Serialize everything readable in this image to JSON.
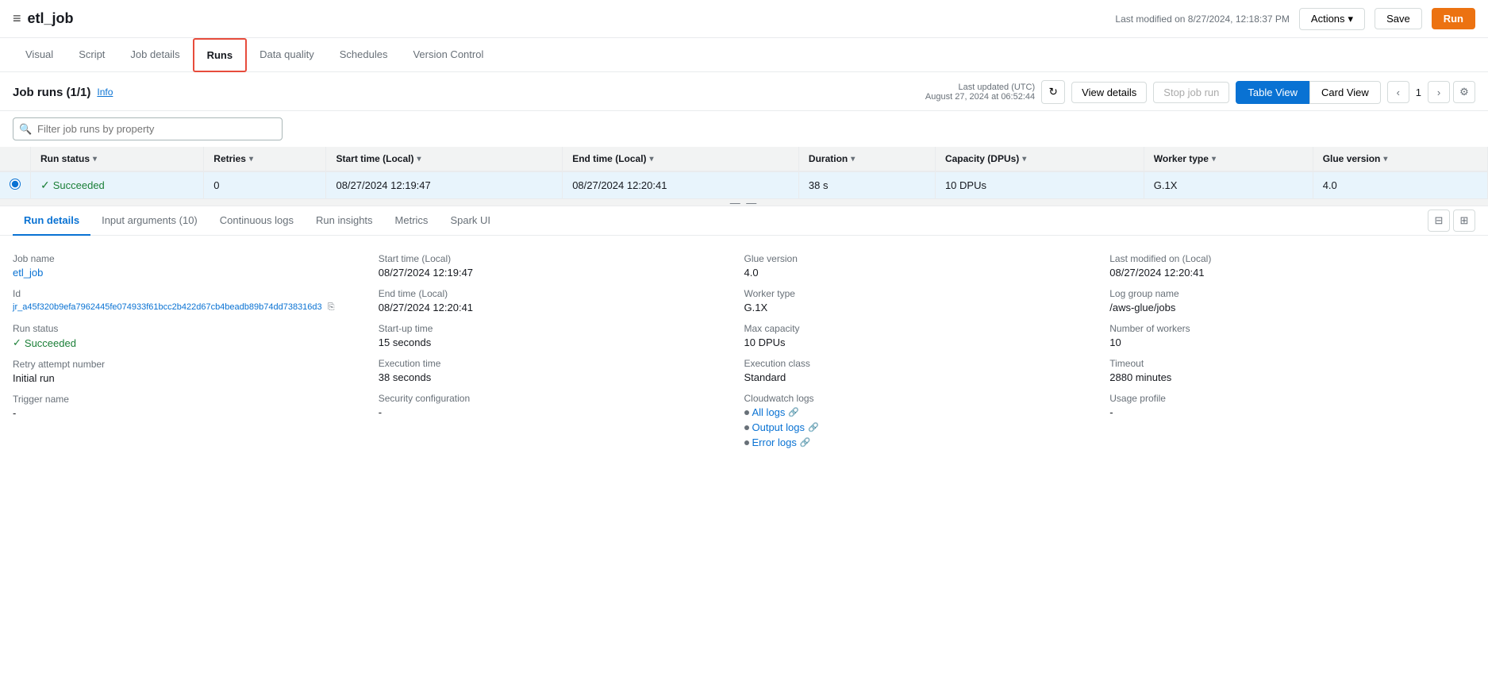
{
  "header": {
    "menu_icon": "≡",
    "job_title": "etl_job",
    "last_modified": "Last modified on 8/27/2024, 12:18:37 PM",
    "actions_label": "Actions",
    "save_label": "Save",
    "run_label": "Run"
  },
  "tabs": [
    {
      "id": "visual",
      "label": "Visual",
      "active": false
    },
    {
      "id": "script",
      "label": "Script",
      "active": false
    },
    {
      "id": "job-details",
      "label": "Job details",
      "active": false
    },
    {
      "id": "runs",
      "label": "Runs",
      "active": true,
      "highlighted": true
    },
    {
      "id": "data-quality",
      "label": "Data quality",
      "active": false
    },
    {
      "id": "schedules",
      "label": "Schedules",
      "active": false
    },
    {
      "id": "version-control",
      "label": "Version Control",
      "active": false
    }
  ],
  "job_runs": {
    "title": "Job runs",
    "count": "(1/1)",
    "info_label": "Info",
    "last_updated_line1": "Last updated (UTC)",
    "last_updated_line2": "August 27, 2024 at 06:52:44",
    "view_details_label": "View details",
    "stop_job_label": "Stop job run",
    "table_view_label": "Table View",
    "card_view_label": "Card View"
  },
  "filter": {
    "placeholder": "Filter job runs by property"
  },
  "table": {
    "columns": [
      {
        "id": "run_status",
        "label": "Run status"
      },
      {
        "id": "retries",
        "label": "Retries"
      },
      {
        "id": "start_time",
        "label": "Start time (Local)"
      },
      {
        "id": "end_time",
        "label": "End time (Local)"
      },
      {
        "id": "duration",
        "label": "Duration"
      },
      {
        "id": "capacity",
        "label": "Capacity (DPUs)"
      },
      {
        "id": "worker_type",
        "label": "Worker type"
      },
      {
        "id": "glue_version",
        "label": "Glue version"
      }
    ],
    "rows": [
      {
        "selected": true,
        "run_status": "Succeeded",
        "retries": "0",
        "start_time": "08/27/2024 12:19:47",
        "end_time": "08/27/2024 12:20:41",
        "duration": "38 s",
        "capacity": "10 DPUs",
        "worker_type": "G.1X",
        "glue_version": "4.0"
      }
    ]
  },
  "pagination": {
    "current_page": "1"
  },
  "bottom_tabs": [
    {
      "id": "run-details",
      "label": "Run details",
      "active": true
    },
    {
      "id": "input-arguments",
      "label": "Input arguments (10)",
      "active": false
    },
    {
      "id": "continuous-logs",
      "label": "Continuous logs",
      "active": false
    },
    {
      "id": "run-insights",
      "label": "Run insights",
      "active": false
    },
    {
      "id": "metrics",
      "label": "Metrics",
      "active": false
    },
    {
      "id": "spark-ui",
      "label": "Spark UI",
      "active": false
    }
  ],
  "run_details": {
    "job_name_label": "Job name",
    "job_name_value": "etl_job",
    "id_label": "Id",
    "id_value": "jr_a45f320b9efa7962445fe074933f61bcc2b422d67cb4beadb89b74dd738316d3",
    "run_status_label": "Run status",
    "run_status_value": "Succeeded",
    "retry_label": "Retry attempt number",
    "retry_value": "Initial run",
    "trigger_label": "Trigger name",
    "trigger_value": "-",
    "start_time_label": "Start time (Local)",
    "start_time_value": "08/27/2024 12:19:47",
    "end_time_label": "End time (Local)",
    "end_time_value": "08/27/2024 12:20:41",
    "startup_time_label": "Start-up time",
    "startup_time_value": "15 seconds",
    "execution_time_label": "Execution time",
    "execution_time_value": "38 seconds",
    "security_config_label": "Security configuration",
    "security_config_value": "-",
    "glue_version_label": "Glue version",
    "glue_version_value": "4.0",
    "worker_type_label": "Worker type",
    "worker_type_value": "G.1X",
    "max_capacity_label": "Max capacity",
    "max_capacity_value": "10 DPUs",
    "execution_class_label": "Execution class",
    "execution_class_value": "Standard",
    "cloudwatch_label": "Cloudwatch logs",
    "all_logs_label": "All logs",
    "output_logs_label": "Output logs",
    "error_logs_label": "Error logs",
    "last_modified_label": "Last modified on (Local)",
    "last_modified_value": "08/27/2024 12:20:41",
    "log_group_label": "Log group name",
    "log_group_value": "/aws-glue/jobs",
    "num_workers_label": "Number of workers",
    "num_workers_value": "10",
    "timeout_label": "Timeout",
    "timeout_value": "2880 minutes",
    "usage_profile_label": "Usage profile",
    "usage_profile_value": "-"
  }
}
